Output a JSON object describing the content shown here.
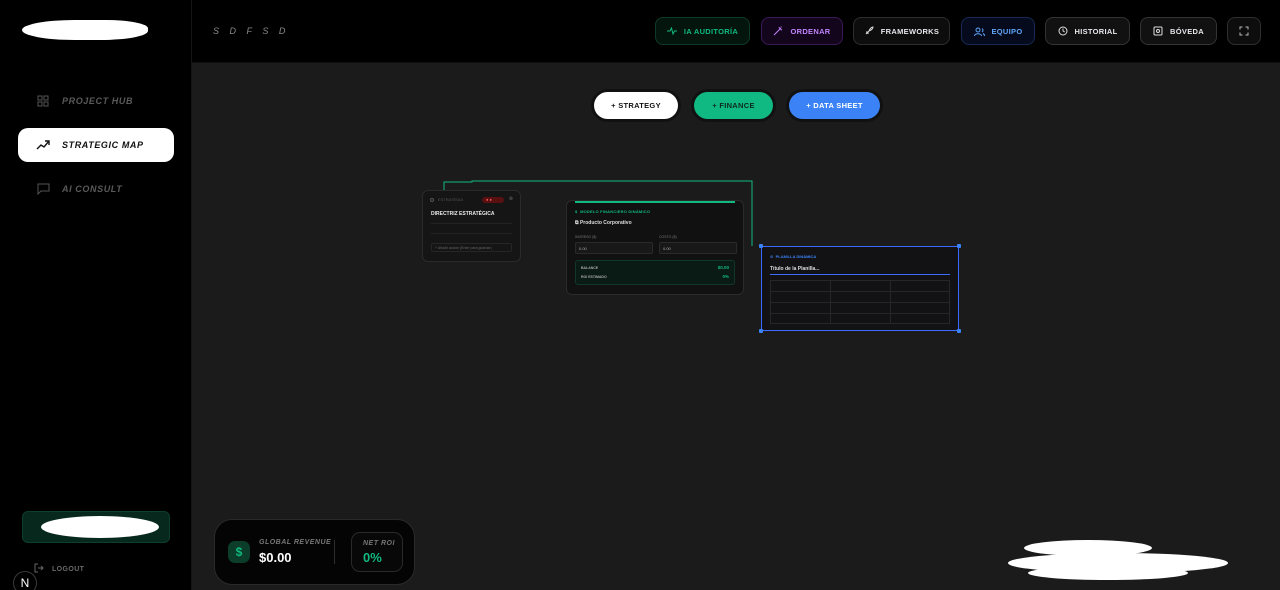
{
  "sidebar": {
    "items": [
      {
        "label": "PROJECT HUB",
        "icon": "grid-icon",
        "active": false
      },
      {
        "label": "STRATEGIC MAP",
        "icon": "trending-up-icon",
        "active": true
      },
      {
        "label": "AI CONSULT",
        "icon": "chat-icon",
        "active": false
      }
    ],
    "logout_label": "LOGOUT",
    "badge_letter": "N"
  },
  "topbar": {
    "project_title": "S D F S D",
    "buttons": [
      {
        "label": "IA AUDITORÍA",
        "icon": "activity-icon",
        "color": "#10b981"
      },
      {
        "label": "ORDENAR",
        "icon": "wand-icon",
        "color": "#c084fc"
      },
      {
        "label": "FRAMEWORKS",
        "icon": "rocket-icon",
        "color": "#e5e7eb"
      },
      {
        "label": "EQUIPO",
        "icon": "users-icon",
        "color": "#60a5fa"
      },
      {
        "label": "HISTORIAL",
        "icon": "history-icon",
        "color": "#e5e7eb"
      },
      {
        "label": "BÓVEDA",
        "icon": "vault-icon",
        "color": "#e5e7eb"
      }
    ],
    "fullscreen_icon": "expand-icon"
  },
  "canvas": {
    "add_buttons": [
      {
        "label": "+ STRATEGY",
        "bg": "#ffffff",
        "fg": "#111111"
      },
      {
        "label": "+ FINANCE",
        "bg": "#10b981",
        "fg": "#0b2a1e"
      },
      {
        "label": "+ DATA SHEET",
        "bg": "#3b82f6",
        "fg": "#ffffff"
      }
    ],
    "strategy_node": {
      "header": "ESTRATEGIA",
      "tag": "● ●",
      "title": "DIRECTRIZ ESTRATÉGICA",
      "input_text": "+ Añadir acción (Enter para guardar)"
    },
    "finance_node": {
      "header": "MODELO FINANCIERO DINÁMICO",
      "title": "Producto Corporativo",
      "income_label": "INGRESO ($)",
      "income_value": "0.00",
      "cost_label": "COSTO ($)",
      "cost_value": "0.00",
      "balance_label": "BALANCE",
      "balance_value": "$0.00",
      "roi_label": "ROI ESTIMADO",
      "roi_value": "0%"
    },
    "sheet_node": {
      "header": "PLANILLA DINÁMICA",
      "title": "Título de la Planilla..."
    }
  },
  "stats": {
    "revenue_label": "GLOBAL REVENUE",
    "revenue_value": "$0.00",
    "roi_label": "NET ROI",
    "roi_value": "0%"
  }
}
